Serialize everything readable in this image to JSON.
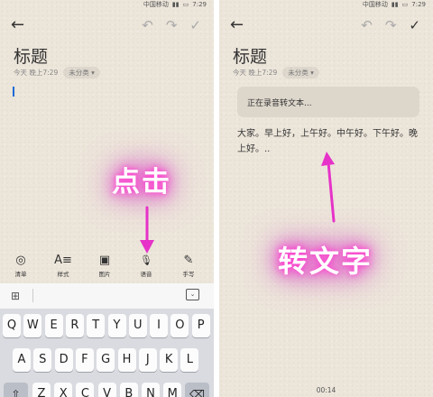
{
  "left_phone": {
    "status_bar": {
      "carrier": "中国移动",
      "time": "7:29"
    },
    "nav": {
      "back_icon": "←",
      "undo_icon": "↶",
      "redo_icon": "↷",
      "done_icon": "✓"
    },
    "note": {
      "title": "标题",
      "date": "今天 晚上7:29",
      "category": "未分类"
    },
    "annotation": "点击",
    "toolbar": [
      {
        "icon": "check-circle-icon",
        "glyph": "◎",
        "label": "清单"
      },
      {
        "icon": "text-style-icon",
        "glyph": "A≡",
        "label": "样式"
      },
      {
        "icon": "image-icon",
        "glyph": "▣",
        "label": "图片"
      },
      {
        "icon": "microphone-icon",
        "glyph": "🎙",
        "label": "语音"
      },
      {
        "icon": "pen-icon",
        "glyph": "✎",
        "label": "手写"
      }
    ],
    "keyboard": {
      "grid_icon": "⊞",
      "hide_icon": "⌄",
      "row1": [
        "Q",
        "W",
        "E",
        "R",
        "T",
        "Y",
        "U",
        "I",
        "O",
        "P"
      ],
      "row2": [
        "A",
        "S",
        "D",
        "F",
        "G",
        "H",
        "J",
        "K",
        "L"
      ],
      "row3": [
        "Z",
        "X",
        "C",
        "V",
        "B",
        "N",
        "M"
      ],
      "shift_icon": "⇧",
      "delete_icon": "⌫"
    }
  },
  "right_phone": {
    "status_bar": {
      "carrier": "中国移动",
      "time": "7:29"
    },
    "nav": {
      "back_icon": "←",
      "undo_icon": "↶",
      "redo_icon": "↷",
      "done_icon": "✓"
    },
    "note": {
      "title": "标题",
      "date": "今天 晚上7:29",
      "category": "未分类"
    },
    "recording_status": "正在录音转文本...",
    "body_text": "大家。早上好，上午好。中午好。下午好。晚上好。..",
    "annotation": "转文字",
    "timer": "00:14"
  },
  "colors": {
    "annotation_glow": "#ff3fd0",
    "arrow": "#e632c8",
    "cursor": "#1e6bd6",
    "paper": "#ece5da"
  }
}
